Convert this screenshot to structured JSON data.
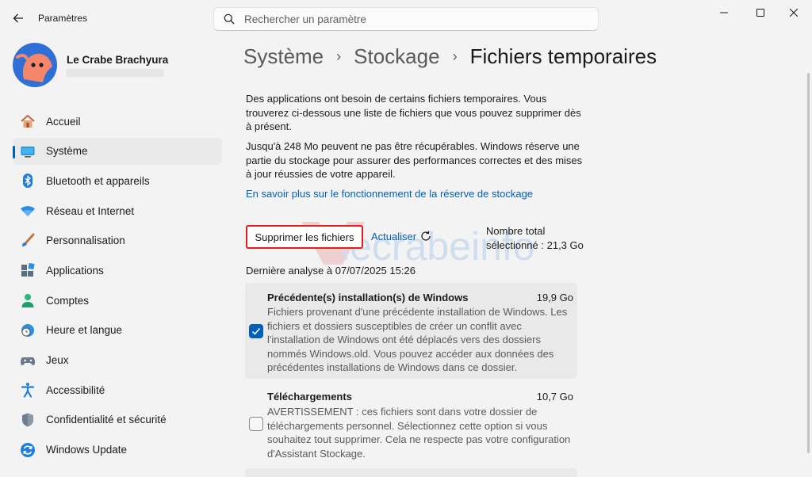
{
  "window": {
    "app_title": "Paramètres",
    "controls": [
      "minimize-icon",
      "maximize-icon",
      "close-icon"
    ]
  },
  "search": {
    "placeholder": "Rechercher un paramètre",
    "value": ""
  },
  "user": {
    "name": "Le Crabe Brachyura"
  },
  "sidebar": {
    "items": [
      {
        "label": "Accueil",
        "icon": "home-icon"
      },
      {
        "label": "Système",
        "icon": "system-icon",
        "active": true
      },
      {
        "label": "Bluetooth et appareils",
        "icon": "bluetooth-icon"
      },
      {
        "label": "Réseau et Internet",
        "icon": "wifi-icon"
      },
      {
        "label": "Personnalisation",
        "icon": "brush-icon"
      },
      {
        "label": "Applications",
        "icon": "apps-icon"
      },
      {
        "label": "Comptes",
        "icon": "account-icon"
      },
      {
        "label": "Heure et langue",
        "icon": "clock-globe-icon"
      },
      {
        "label": "Jeux",
        "icon": "gamepad-icon"
      },
      {
        "label": "Accessibilité",
        "icon": "accessibility-icon"
      },
      {
        "label": "Confidentialité et sécurité",
        "icon": "shield-icon"
      },
      {
        "label": "Windows Update",
        "icon": "update-icon"
      }
    ]
  },
  "breadcrumb": {
    "level1": "Système",
    "level2": "Stockage",
    "current": "Fichiers temporaires",
    "separator": "›"
  },
  "content": {
    "intro": "Des applications ont besoin de certains fichiers temporaires. Vous trouverez ci-dessous une liste de fichiers que vous pouvez supprimer dès à présent.",
    "reserve": "Jusqu'à 248 Mo peuvent ne pas être récupérables. Windows réserve une partie du stockage pour assurer des performances correctes et des mises à jour réussies de votre appareil.",
    "learn_more": "En savoir plus sur le fonctionnement de la réserve de stockage",
    "delete_button": "Supprimer les fichiers",
    "refresh_label": "Actualiser",
    "total_line1": "Nombre total",
    "total_line2": "sélectionné : 21,3 Go",
    "last_scan": "Dernière analyse à 07/07/2025 15:26",
    "items": [
      {
        "title": "Précédente(s) installation(s) de Windows",
        "size": "19,9 Go",
        "checked": true,
        "description": "Fichiers provenant d'une précédente installation de Windows. Les fichiers et dossiers susceptibles de créer un conflit avec l'installation de Windows ont été déplacés vers des dossiers nommés Windows.old. Vous pouvez accéder aux données des précédentes installations de Windows dans ce dossier."
      },
      {
        "title": "Téléchargements",
        "size": "10,7 Go",
        "checked": false,
        "description": "AVERTISSEMENT : ces fichiers sont dans votre dossier de téléchargements personnel. Sélectionnez cette option si vous souhaitez tout supprimer. Cela ne respecte pas votre configuration d'Assistant Stockage."
      }
    ]
  },
  "watermark": "lecrabeinfo",
  "colors": {
    "accent": "#005fb8",
    "highlight_border": "#e0201f",
    "card_bg": "#e9e9e9",
    "window_bg": "#f3f3f3"
  }
}
